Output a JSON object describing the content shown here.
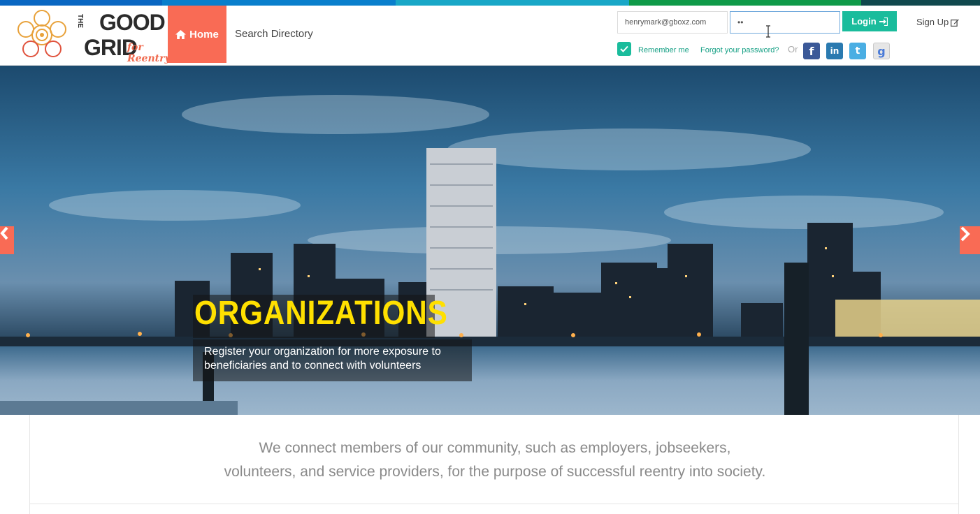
{
  "top_strip_colors": [
    "#0a67c2",
    "#0a7fcc",
    "#19a7c7",
    "#0f9a48",
    "#10484d"
  ],
  "logo": {
    "the": "THE",
    "good": "GOOD",
    "grid": "GRID",
    "tagline": "for Reentry"
  },
  "nav": {
    "home_label": "Home",
    "search_label": "Search Directory"
  },
  "login": {
    "email_value": "henrymark@gboxz.com",
    "password_value": "••",
    "button_label": "Login",
    "signup_label": "Sign Up",
    "remember_label": "Remember me",
    "forgot_label": "Forgot your password?",
    "or_label": "Or"
  },
  "social": {
    "facebook": "f",
    "linkedin": "in",
    "twitter": "t",
    "google": "g"
  },
  "hero": {
    "title": "ORGANIZATIONS",
    "text": "Register your organization for more exposure to beneficiaries and to connect with volunteers"
  },
  "tagline": {
    "line1": "We connect members of our community, such as employers, jobseekers,",
    "line2": "volunteers, and service providers, for the purpose of successful reentry into society."
  },
  "colors": {
    "accent": "#f96b55",
    "teal": "#1abc9c",
    "title_yellow": "#ffe000"
  }
}
